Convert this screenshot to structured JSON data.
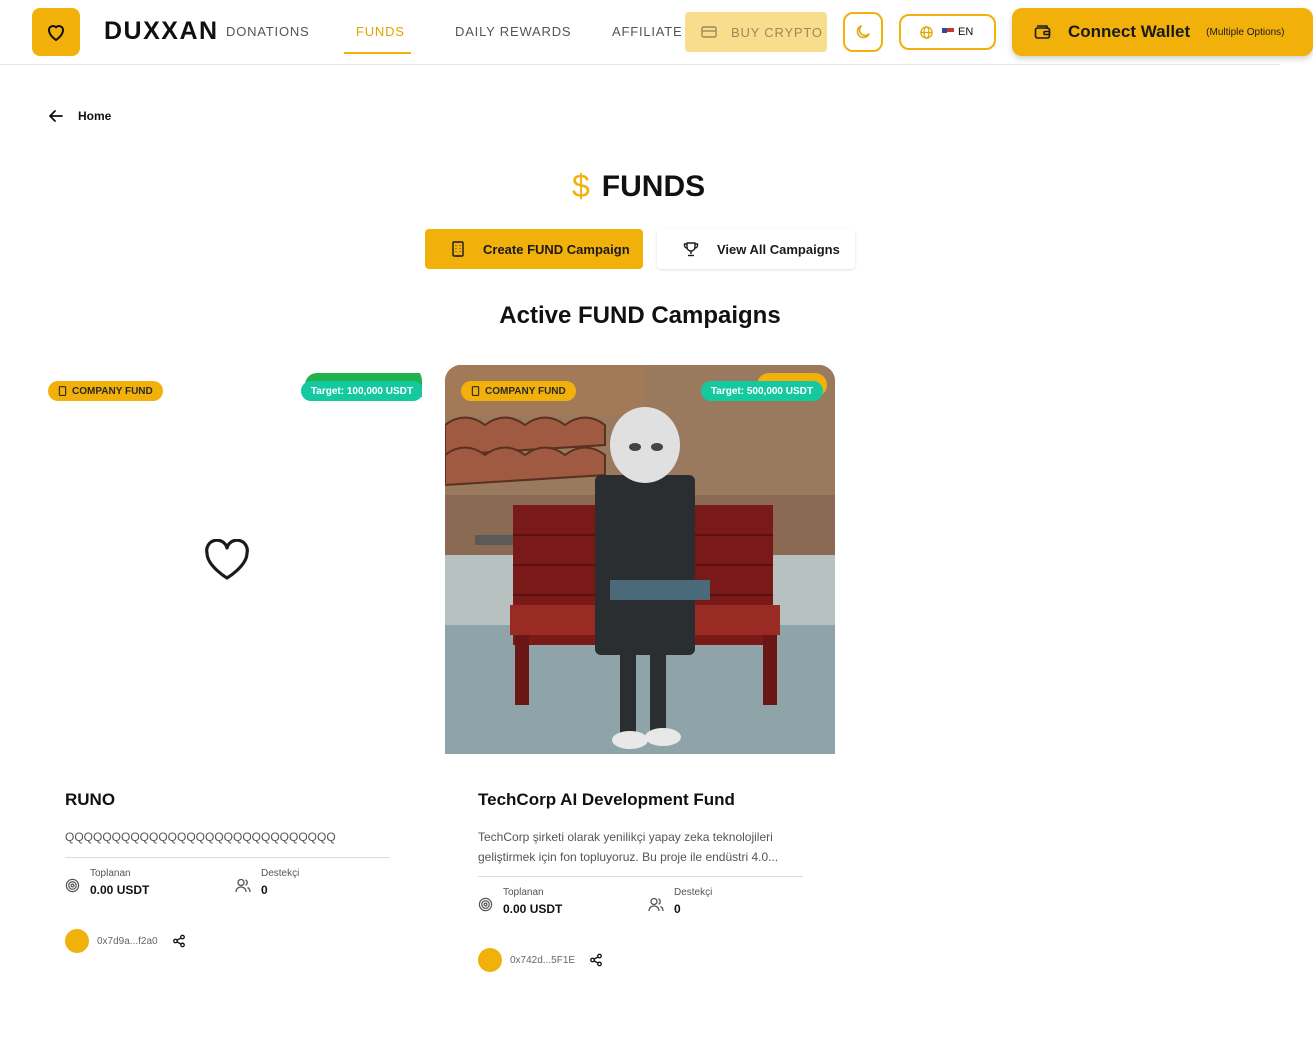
{
  "header": {
    "brand": "DUXXAN",
    "nav": [
      {
        "label": "DONATIONS"
      },
      {
        "label": "FUNDS"
      },
      {
        "label": "DAILY REWARDS"
      },
      {
        "label": "AFFILIATE"
      }
    ],
    "buy_crypto": "BUY CRYPTO",
    "language": "EN",
    "wallet_label": "Connect Wallet",
    "wallet_sub": "(Multiple Options)"
  },
  "breadcrumb": {
    "back_label": "Home"
  },
  "page": {
    "title_icon": "$",
    "title": "FUNDS",
    "create_button": "Create FUND Campaign",
    "view_button": "View All Campaigns",
    "section_title": "Active FUND Campaigns"
  },
  "campaigns": [
    {
      "badge": "COMPANY FUND",
      "target": "Target: 100,000 USDT",
      "title": "RUNO",
      "description": "QQQQQQQQQQQQQQQQQQQQQQQQQQQQQ",
      "raised_label": "Toplanan",
      "raised_value": "0.00 USDT",
      "supporters_label": "Destekçi",
      "supporters_value": "0",
      "owner": "0x7d9a...f2a0",
      "image": "heart-placeholder"
    },
    {
      "badge": "COMPANY FUND",
      "target": "Target: 500,000 USDT",
      "title": "TechCorp AI Development Fund",
      "description": "TechCorp şirketi olarak yenilikçi yapay zeka teknolojileri geliştirmek için fon topluyoruz. Bu proje ile endüstri 4.0...",
      "raised_label": "Toplanan",
      "raised_value": "0.00 USDT",
      "supporters_label": "Destekçi",
      "supporters_value": "0",
      "owner": "0x742d...5F1E",
      "image": "robot-on-bench-photo"
    }
  ],
  "colors": {
    "accent": "#f2b10a",
    "target": "#14c8a0"
  }
}
